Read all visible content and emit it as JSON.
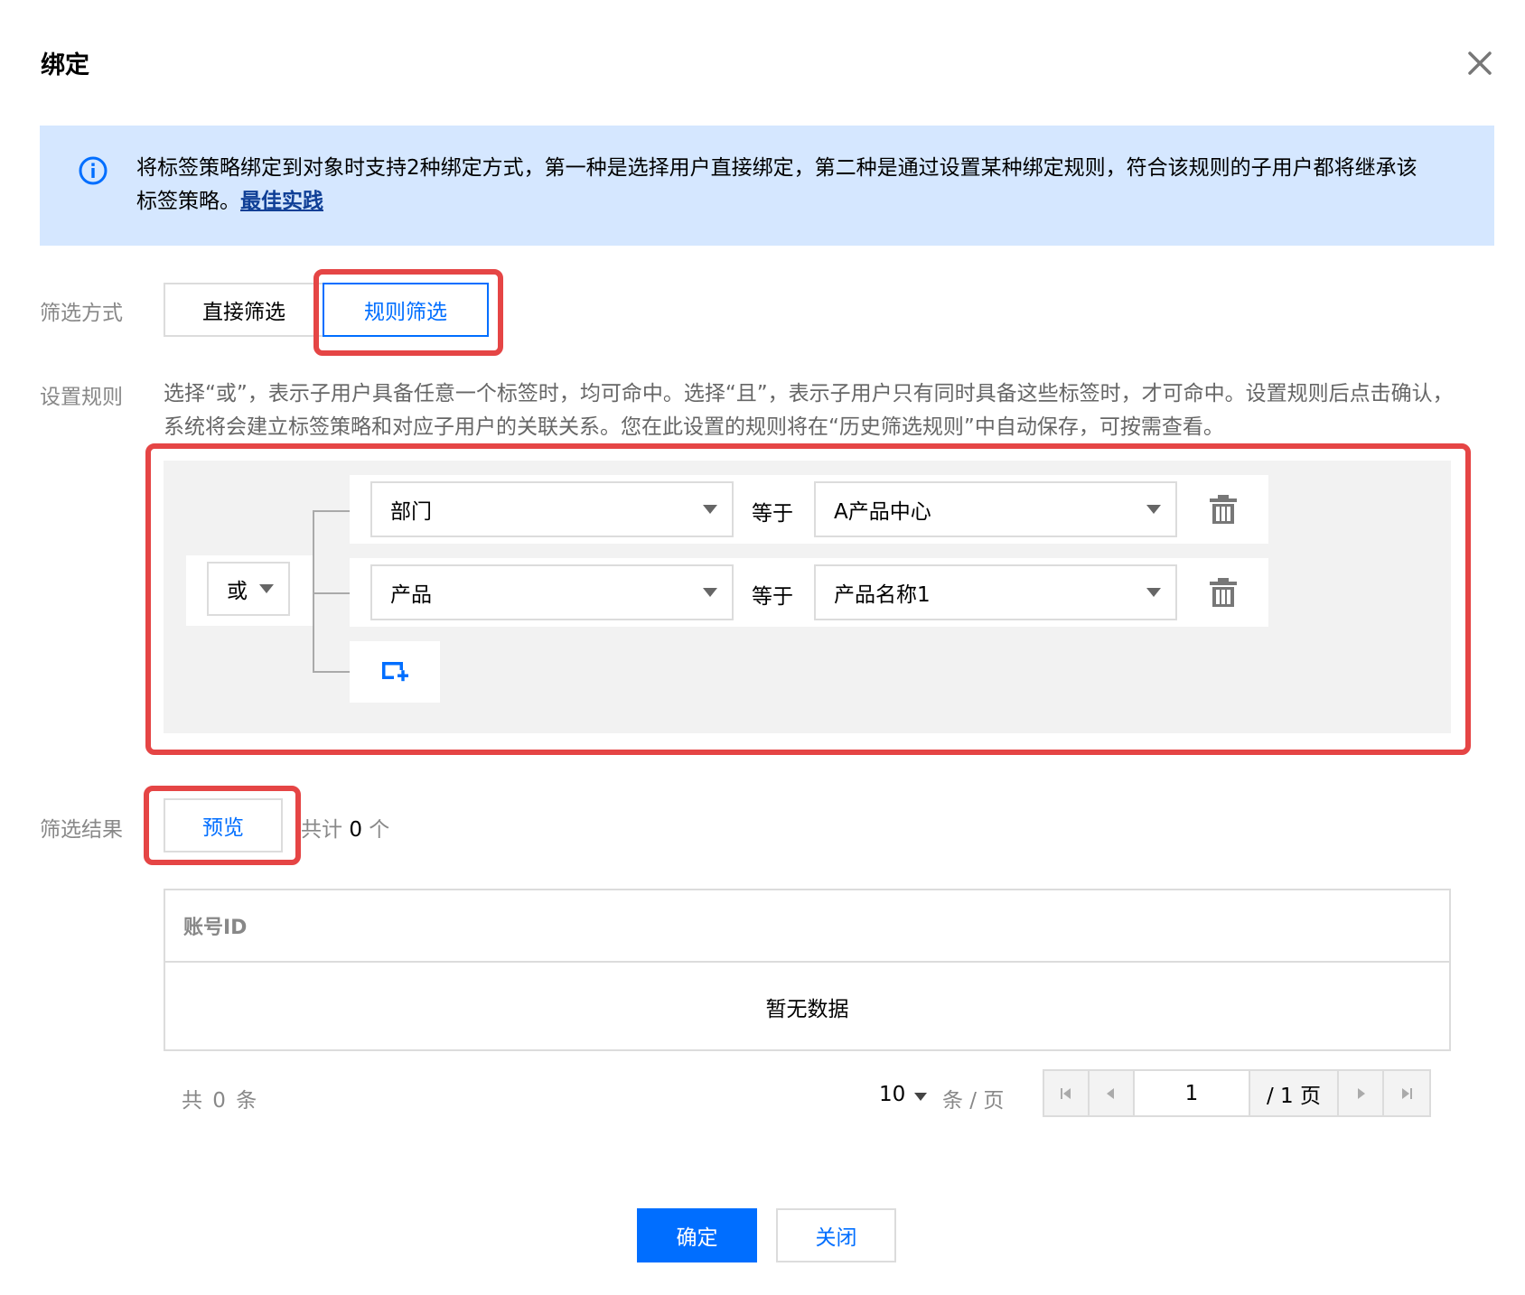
{
  "dialog": {
    "title": "绑定"
  },
  "info": {
    "text": "将标签策略绑定到对象时支持2种绑定方式，第一种是选择用户直接绑定，第二种是通过设置某种绑定规则，符合该规则的子用户都将继承该标签策略。",
    "link": "最佳实践"
  },
  "filter": {
    "label": "筛选方式",
    "options": [
      "直接筛选",
      "规则筛选"
    ],
    "selected": "规则筛选"
  },
  "rules": {
    "label": "设置规则",
    "description": "选择“或”，表示子用户具备任意一个标签时，均可命中。选择“且”，表示子用户只有同时具备这些标签时，才可命中。设置规则后点击确认，系统将会建立标签策略和对应子用户的关联关系。您在此设置的规则将在“历史筛选规则”中自动保存，可按需查看。",
    "logic": "或",
    "items": [
      {
        "key": "部门",
        "operator": "等于",
        "value": "A产品中心"
      },
      {
        "key": "产品",
        "operator": "等于",
        "value": "产品名称1"
      }
    ]
  },
  "result": {
    "label": "筛选结果",
    "preview_label": "预览",
    "count_prefix": "共计",
    "count": "0",
    "count_suffix": "个"
  },
  "table": {
    "column": "账号ID",
    "empty_text": "暂无数据"
  },
  "pagination": {
    "total_text": "共 0 条",
    "page_size": "10",
    "page_size_unit": "条 / 页",
    "current_page": "1",
    "total_pages_text": "/ 1 页"
  },
  "footer": {
    "confirm": "确定",
    "close": "关闭"
  },
  "colors": {
    "primary": "#006eff",
    "info_bg": "#d5e7ff",
    "highlight": "#e54545"
  }
}
